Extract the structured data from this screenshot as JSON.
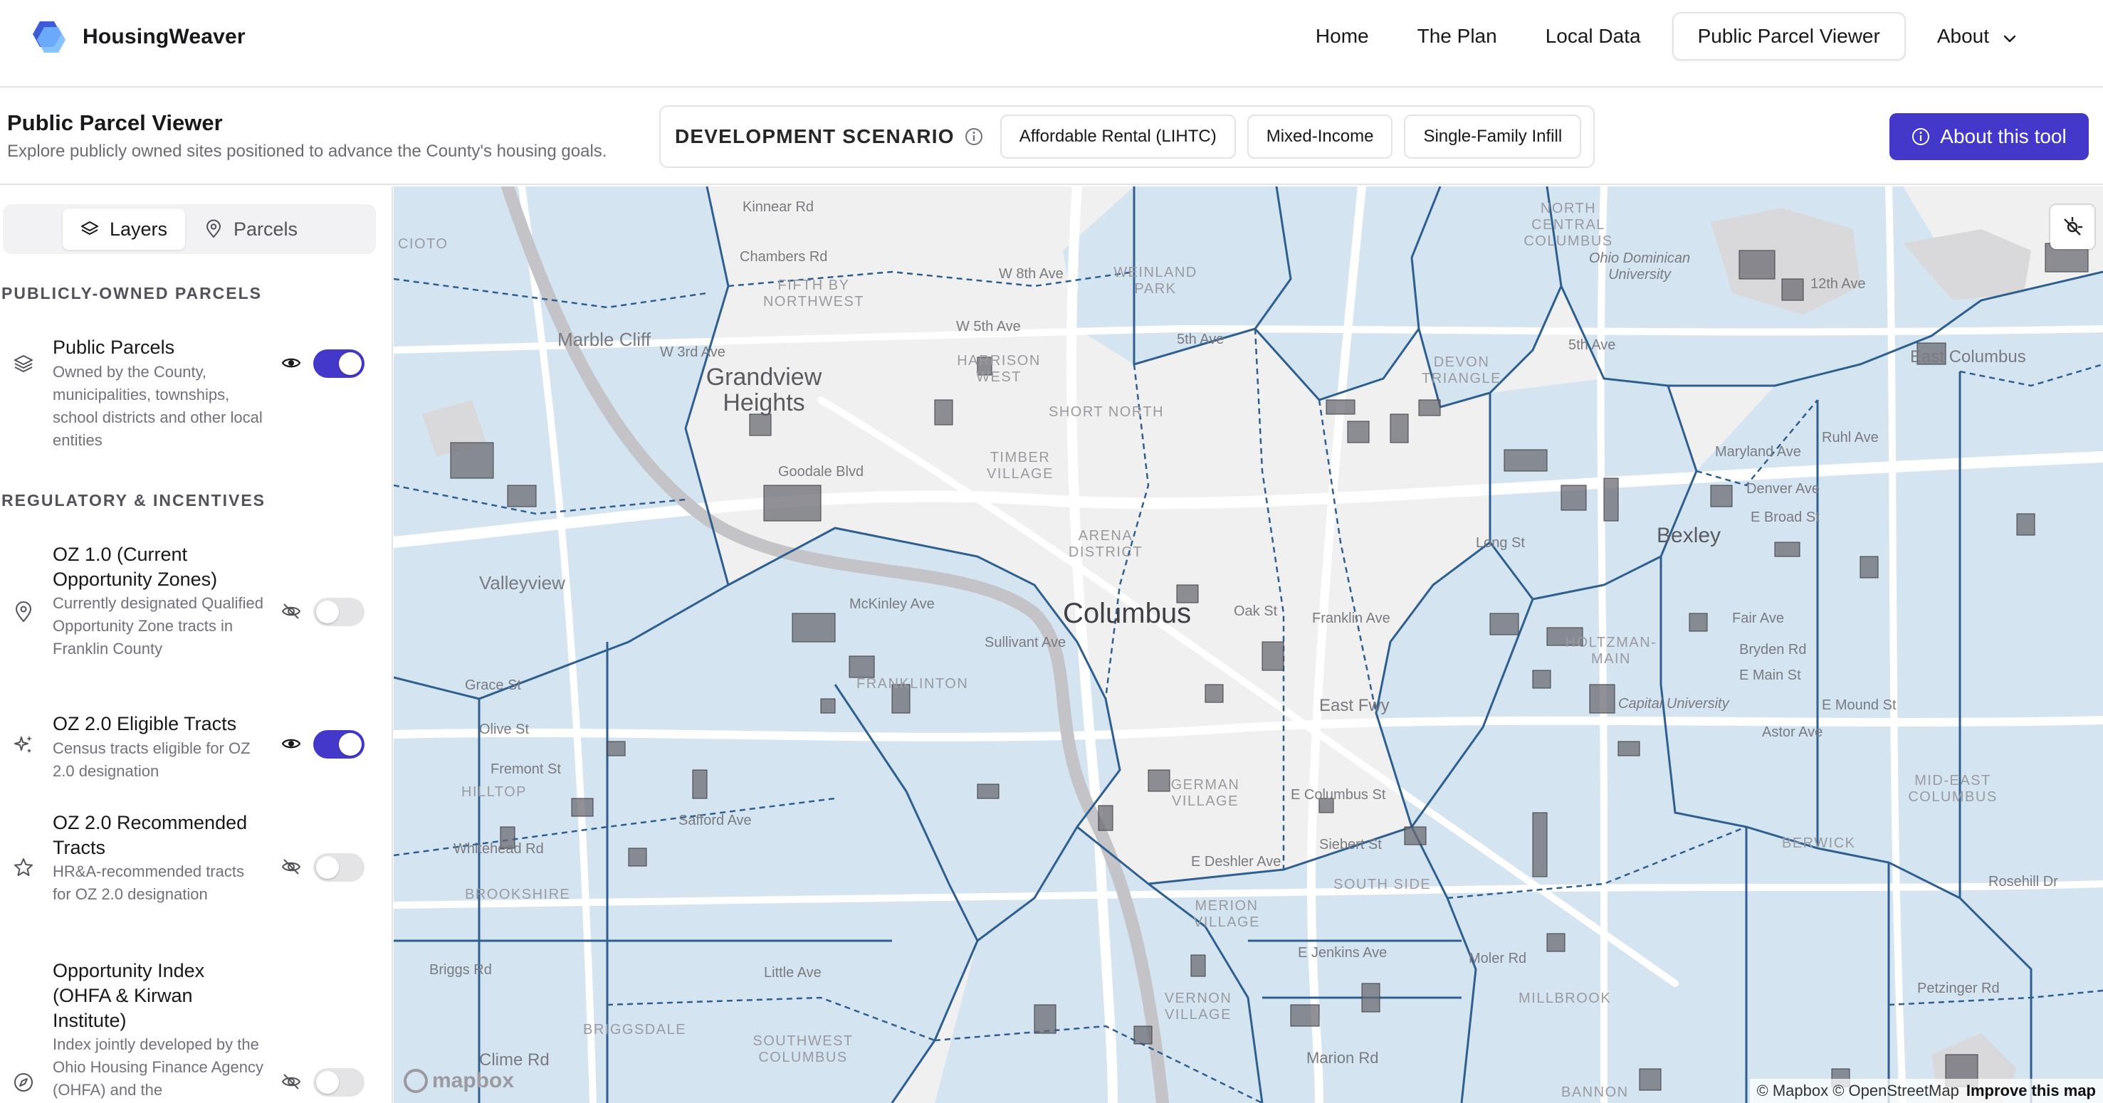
{
  "brand": {
    "name": "HousingWeaver"
  },
  "nav": {
    "items": [
      {
        "label": "Home",
        "active": false
      },
      {
        "label": "The Plan",
        "active": false
      },
      {
        "label": "Local Data",
        "active": false
      },
      {
        "label": "Public Parcel Viewer",
        "active": true
      },
      {
        "label": "About",
        "active": false,
        "dropdown": true
      }
    ]
  },
  "header": {
    "title": "Public Parcel Viewer",
    "subtitle": "Explore publicly owned sites positioned to advance the County's housing goals.",
    "scenario_label": "DEVELOPMENT SCENARIO",
    "scenarios": [
      "Affordable Rental (LIHTC)",
      "Mixed-Income",
      "Single-Family Infill"
    ],
    "about_button": "About this tool",
    "accent_color": "#4338ca"
  },
  "sidebar": {
    "tabs": [
      {
        "label": "Layers",
        "icon": "layers-icon",
        "active": true
      },
      {
        "label": "Parcels",
        "icon": "map-pin-icon",
        "active": false
      }
    ],
    "sections": [
      {
        "title": "PUBLICLY-OWNED PARCELS",
        "layers": [
          {
            "name": "Public Parcels",
            "description": "Owned by the County, municipalities, townships, school districts and other local entities",
            "icon": "layers-icon",
            "visible": true,
            "enabled": true
          }
        ]
      },
      {
        "title": "REGULATORY & INCENTIVES",
        "layers": [
          {
            "name": "OZ 1.0 (Current Opportunity Zones)",
            "description": "Currently designated Qualified Opportunity Zone tracts in Franklin County",
            "icon": "map-pin-icon",
            "visible": false,
            "enabled": false
          },
          {
            "name": "OZ 2.0 Eligible Tracts",
            "description": "Census tracts eligible for OZ 2.0 designation",
            "icon": "sparkles-icon",
            "visible": true,
            "enabled": true
          },
          {
            "name": "OZ 2.0 Recommended Tracts",
            "description": "HR&A-recommended tracts for OZ 2.0 designation",
            "icon": "star-icon",
            "visible": false,
            "enabled": false
          },
          {
            "name": "Opportunity Index (OHFA & Kirwan Institute)",
            "description": "Index jointly developed by the Ohio Housing Finance Agency (OHFA) and the",
            "icon": "compass-icon",
            "visible": false,
            "enabled": false
          }
        ]
      }
    ]
  },
  "map": {
    "tract_fill": "#cfe3f1",
    "tract_stroke": "#2f5f8f",
    "parcel_fill": "#6b6b73",
    "labels": {
      "north_central": "NORTH CENTRAL COLUMBUS",
      "fifth_by_northwest": "FIFTH BY NORTHWEST",
      "weinland_park": "WEINLAND PARK",
      "ohio_dominican": "Ohio Dominican University",
      "harrison_west": "HARRISON WEST",
      "devon_triangle": "DEVON TRIANGLE",
      "east_columbus": "East Columbus",
      "grandview": "Grandview Heights",
      "marble_cliff": "Marble Cliff",
      "short_north": "SHORT NORTH",
      "timber_village": "TIMBER VILLAGE",
      "arena_district": "ARENA DISTRICT",
      "columbus": "Columbus",
      "bexley": "Bexley",
      "valleyview": "Valleyview",
      "franklinton": "FRANKLINTON",
      "holtzman_main": "HOLTZMAN-MAIN",
      "capital_university": "Capital University",
      "mid_east": "MID-EAST COLUMBUS",
      "german_village": "GERMAN VILLAGE",
      "merion_village": "MERION VILLAGE",
      "south_side": "SOUTH SIDE",
      "brookshire": "BROOKSHIRE",
      "hilltop": "HILLTOP",
      "briggsdale": "BRIGGSDALE",
      "southwest_columbus": "SOUTHWEST COLUMBUS",
      "millbrook": "MILLBROOK",
      "vernon_village": "VERNON VILLAGE",
      "berwick": "BERWICK",
      "bannon": "BANNON",
      "cioto": "CIOTO",
      "w_third": "W 3rd Ave",
      "w_fifth": "W 5th Ave",
      "w_eighth": "W 8th Ave",
      "e_fifth": "5th Ave",
      "e_twelfth": "12th Ave",
      "e_fifth_ave": "5th Ave",
      "maryland": "Maryland Ave",
      "denver": "Denver Ave",
      "broad": "E Broad St",
      "franklin_ave": "Franklin Ave",
      "oak_st": "Oak St",
      "long_st": "Long St",
      "fair_ave": "Fair Ave",
      "bryden": "Bryden Rd",
      "main_st": "E Main St",
      "mound": "E Mound St",
      "astor": "Astor Ave",
      "east_fwy": "East Fwy",
      "deshler": "E Deshler Ave",
      "siebert": "Siebert St",
      "jenkins": "E Jenkins Ave",
      "moler": "Moler Rd",
      "marion": "Marion Rd",
      "petzinger": "Petzinger Rd",
      "safford": "Safford Ave",
      "whitehead": "Whitehead Rd",
      "mckinley": "McKinley Ave",
      "briggs": "Briggs Rd",
      "little_ave": "Little Ave",
      "clime": "Clime Rd",
      "sullivant": "Sullivant Ave",
      "grace": "Grace St",
      "olive": "Olive St",
      "fremont": "Fremont St",
      "kinnear": "Kinnear Rd",
      "chambers": "Chambers Rd",
      "columbus_st": "E Columbus St",
      "ruhl": "Ruhl Ave",
      "rosehill": "Rosehill Dr",
      "goodale": "Goodale Blvd",
      "long_st2": "Long St"
    },
    "attribution": "© Mapbox © OpenStreetMap",
    "attribution_link": "Improve this map",
    "logo_text": "mapbox",
    "control_icon": "draw-icon"
  }
}
